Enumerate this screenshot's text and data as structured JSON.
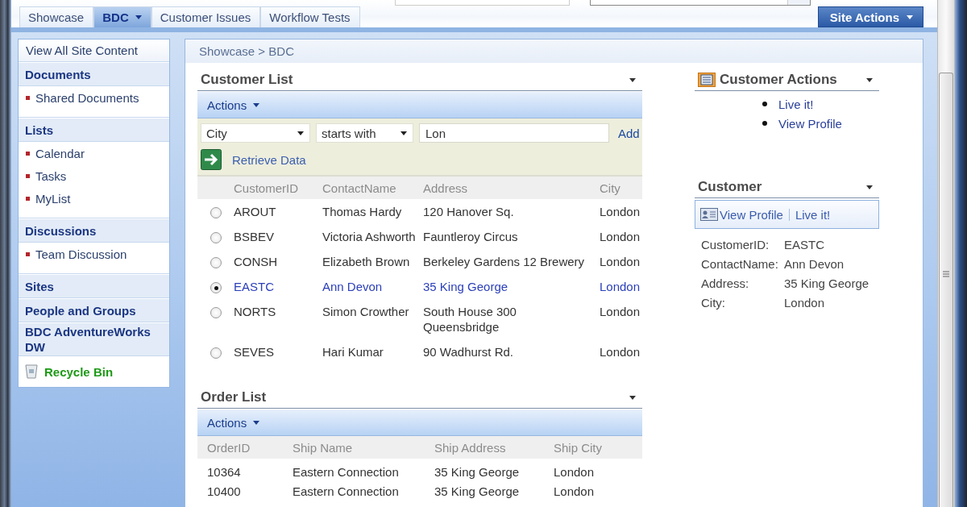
{
  "tabs": [
    {
      "label": "Showcase",
      "selected": false,
      "has_menu": false
    },
    {
      "label": "BDC",
      "selected": true,
      "has_menu": true
    },
    {
      "label": "Customer Issues",
      "selected": false,
      "has_menu": false
    },
    {
      "label": "Workflow Tests",
      "selected": false,
      "has_menu": false
    }
  ],
  "site_actions": {
    "label": "Site Actions"
  },
  "sidebar": {
    "items": [
      {
        "kind": "link",
        "label": "View All Site Content"
      },
      {
        "kind": "heading",
        "label": "Documents",
        "children": [
          {
            "label": "Shared Documents"
          }
        ]
      },
      {
        "kind": "heading",
        "label": "Lists",
        "children": [
          {
            "label": "Calendar"
          },
          {
            "label": "Tasks"
          },
          {
            "label": "MyList"
          }
        ]
      },
      {
        "kind": "heading",
        "label": "Discussions",
        "children": [
          {
            "label": "Team Discussion"
          }
        ]
      },
      {
        "kind": "heading",
        "label": "Sites"
      },
      {
        "kind": "heading",
        "label": "People and Groups"
      },
      {
        "kind": "heading",
        "label": "BDC AdventureWorks DW"
      },
      {
        "kind": "recycle",
        "label": "Recycle Bin"
      }
    ]
  },
  "breadcrumb": "Showcase > BDC",
  "customer_list": {
    "title": "Customer List",
    "actions": "Actions",
    "filter": {
      "field": "City",
      "operator": "starts with",
      "value": "Lon",
      "add": "Add"
    },
    "retrieve": "Retrieve Data",
    "columns": [
      "CustomerID",
      "ContactName",
      "Address",
      "City"
    ],
    "rows": [
      {
        "selected": false,
        "cells": [
          "AROUT",
          "Thomas Hardy",
          "120 Hanover Sq.",
          "London"
        ]
      },
      {
        "selected": false,
        "cells": [
          "BSBEV",
          "Victoria Ashworth",
          "Fauntleroy Circus",
          "London"
        ]
      },
      {
        "selected": false,
        "cells": [
          "CONSH",
          "Elizabeth Brown",
          "Berkeley Gardens 12 Brewery",
          "London"
        ]
      },
      {
        "selected": true,
        "cells": [
          "EASTC",
          "Ann Devon",
          "35 King George",
          "London"
        ]
      },
      {
        "selected": false,
        "cells": [
          "NORTS",
          "Simon Crowther",
          "South House 300\nQueensbridge",
          "London"
        ]
      },
      {
        "selected": false,
        "cells": [
          "SEVES",
          "Hari Kumar",
          "90 Wadhurst Rd.",
          "London"
        ]
      }
    ]
  },
  "order_list": {
    "title": "Order List",
    "actions": "Actions",
    "columns": [
      "OrderID",
      "Ship Name",
      "Ship Address",
      "Ship City"
    ],
    "rows": [
      [
        "10364",
        "Eastern Connection",
        "35 King George",
        "London"
      ],
      [
        "10400",
        "Eastern Connection",
        "35 King George",
        "London"
      ]
    ]
  },
  "customer_actions": {
    "title": "Customer Actions",
    "links": [
      "Live it!",
      "View Profile"
    ]
  },
  "customer": {
    "title": "Customer",
    "toolbar": [
      "View Profile",
      "Live it!"
    ],
    "fields": [
      {
        "label": "CustomerID:",
        "value": "EASTC"
      },
      {
        "label": "ContactName:",
        "value": "Ann Devon"
      },
      {
        "label": "Address:",
        "value": "35 King George"
      },
      {
        "label": "City:",
        "value": "London"
      }
    ]
  }
}
